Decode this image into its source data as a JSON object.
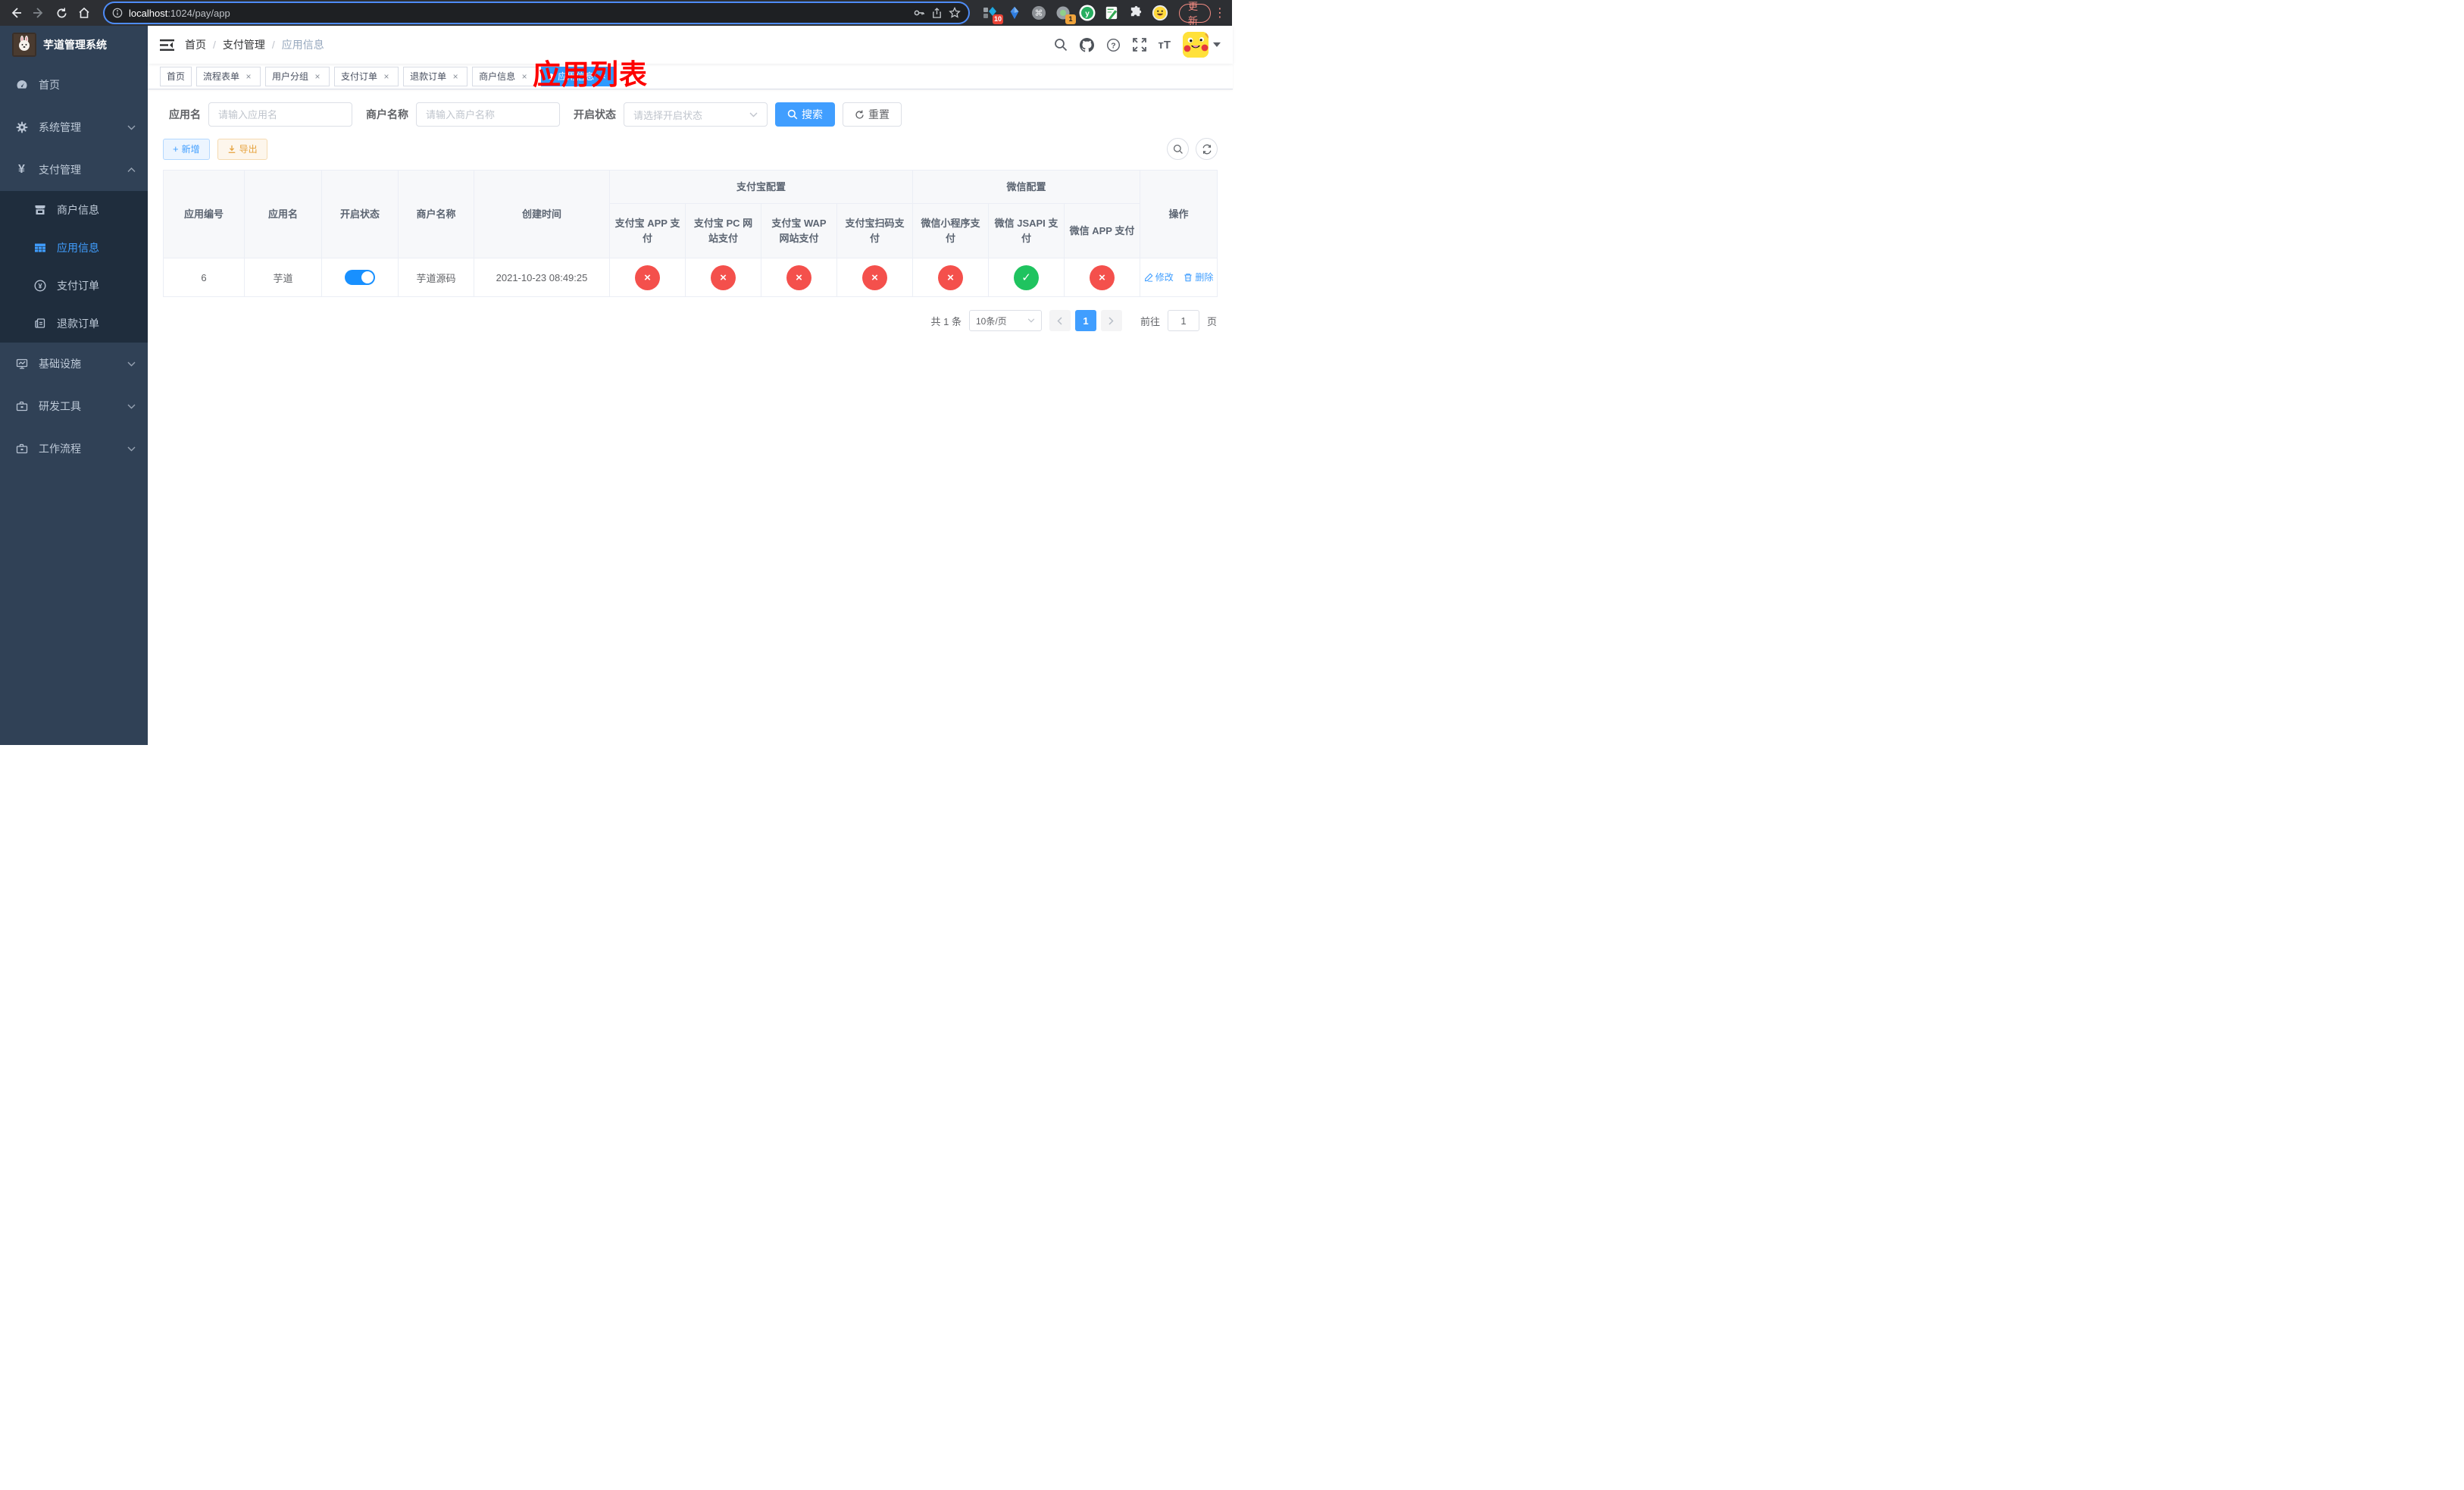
{
  "browser": {
    "url_host": "localhost",
    "url_path": ":1024/pay/app",
    "update_label": "更新",
    "ext_badge_grid": "10",
    "ext_badge_record": "1"
  },
  "sidebar": {
    "title": "芋道管理系统",
    "menu": [
      {
        "label": "首页"
      },
      {
        "label": "系统管理"
      },
      {
        "label": "支付管理"
      },
      {
        "label": "商户信息"
      },
      {
        "label": "应用信息"
      },
      {
        "label": "支付订单"
      },
      {
        "label": "退款订单"
      },
      {
        "label": "基础设施"
      },
      {
        "label": "研发工具"
      },
      {
        "label": "工作流程"
      }
    ]
  },
  "navbar": {
    "breadcrumb": [
      {
        "label": "首页"
      },
      {
        "label": "支付管理"
      },
      {
        "label": "应用信息"
      }
    ],
    "annotation": "应用列表"
  },
  "tabs": [
    {
      "label": "首页",
      "closable": false,
      "active": false
    },
    {
      "label": "流程表单",
      "closable": true,
      "active": false
    },
    {
      "label": "用户分组",
      "closable": true,
      "active": false
    },
    {
      "label": "支付订单",
      "closable": true,
      "active": false
    },
    {
      "label": "退款订单",
      "closable": true,
      "active": false
    },
    {
      "label": "商户信息",
      "closable": true,
      "active": false
    },
    {
      "label": "应用信息",
      "closable": true,
      "active": true
    }
  ],
  "filters": {
    "app_name_label": "应用名",
    "app_name_placeholder": "请输入应用名",
    "merchant_label": "商户名称",
    "merchant_placeholder": "请输入商户名称",
    "status_label": "开启状态",
    "status_placeholder": "请选择开启状态",
    "search_label": "搜索",
    "reset_label": "重置"
  },
  "actions": {
    "add_label": "新增",
    "export_label": "导出"
  },
  "table": {
    "headers": {
      "app_id": "应用编号",
      "app_name": "应用名",
      "status": "开启状态",
      "merchant": "商户名称",
      "created": "创建时间",
      "group_alipay": "支付宝配置",
      "group_wechat": "微信配置",
      "ops": "操作",
      "pay_cols": [
        "支付宝 APP 支付",
        "支付宝 PC 网站支付",
        "支付宝 WAP 网站支付",
        "支付宝扫码支付",
        "微信小程序支付",
        "微信 JSAPI 支付",
        "微信 APP 支付"
      ]
    },
    "row": {
      "id": "6",
      "name": "芋道",
      "switch_on": true,
      "merchant": "芋道源码",
      "created": "2021-10-23 08:49:25",
      "statuses": [
        false,
        false,
        false,
        false,
        false,
        true,
        false
      ],
      "edit_label": "修改",
      "delete_label": "删除"
    }
  },
  "pagination": {
    "total": "共 1 条",
    "page_size": "10条/页",
    "current_page": "1",
    "goto_prefix": "前往",
    "goto_value": "1",
    "goto_suffix": "页"
  },
  "colors": {
    "accent_blue": "#409eff",
    "sidebar_bg": "#304156",
    "submenu_bg": "#1f2d3d",
    "success_green": "#1fc35f",
    "error_red": "#f4504c",
    "warning_orange": "#e6a23c",
    "annotation_red": "#fd0100"
  }
}
